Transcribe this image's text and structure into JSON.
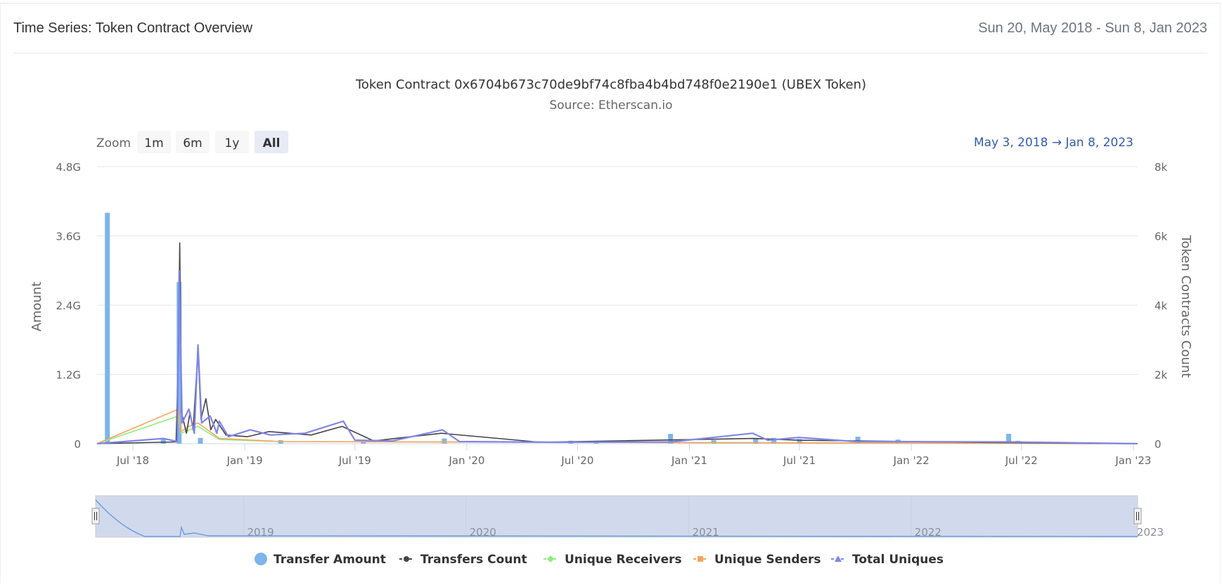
{
  "header": {
    "title": "Time Series: Token Contract Overview",
    "date_range": "Sun 20, May 2018 - Sun 8, Jan 2023"
  },
  "chart_data": {
    "type": "bar",
    "title": "Token Contract 0x6704b673c70de9bf74c8fba4b4bd748f0e2190e1 (UBEX Token)",
    "subtitle": "Source: Etherscan.io",
    "zoom": {
      "label": "Zoom",
      "buttons": [
        "1m",
        "6m",
        "1y",
        "All"
      ],
      "active": "All"
    },
    "range_display": {
      "from": "May 3, 2018",
      "arrow": "→",
      "to": "Jan 8, 2023"
    },
    "ylabel": "Amount",
    "y2label": "Token Contracts Count",
    "ylim": [
      0,
      4800000000
    ],
    "y2lim": [
      0,
      8000
    ],
    "y_ticks": [
      "0",
      "1.2G",
      "2.4G",
      "3.6G",
      "4.8G"
    ],
    "y2_ticks": [
      "0",
      "2k",
      "4k",
      "6k",
      "8k"
    ],
    "x_ticks": [
      "Jul '18",
      "Jan '19",
      "Jul '19",
      "Jan '20",
      "Jul '20",
      "Jan '21",
      "Jul '21",
      "Jan '22",
      "Jul '22",
      "Jan '23"
    ],
    "x_range": [
      "2018-05-03",
      "2023-01-08"
    ],
    "navigator_labels": [
      "2019",
      "2020",
      "2021",
      "2022",
      "2023"
    ],
    "grid": true,
    "legend_position": "bottom",
    "colors": {
      "transfer_amount": "#7cb5ec",
      "transfers_count": "#434348",
      "unique_receivers": "#90ed7d",
      "unique_senders": "#f7a35c",
      "total_uniques": "#8085e9"
    },
    "series": [
      {
        "name": "Transfer Amount",
        "axis": "left",
        "kind": "column",
        "points": [
          [
            "2018-05-20",
            4000000000
          ],
          [
            "2018-08-20",
            80000000
          ],
          [
            "2018-09-15",
            2800000000
          ],
          [
            "2018-10-20",
            100000000
          ],
          [
            "2019-03-01",
            60000000
          ],
          [
            "2019-07-15",
            40000000
          ],
          [
            "2019-11-25",
            90000000
          ],
          [
            "2020-06-20",
            50000000
          ],
          [
            "2020-08-01",
            40000000
          ],
          [
            "2020-12-01",
            170000000
          ],
          [
            "2021-02-10",
            60000000
          ],
          [
            "2021-04-20",
            90000000
          ],
          [
            "2021-05-20",
            100000000
          ],
          [
            "2021-07-01",
            80000000
          ],
          [
            "2021-10-05",
            120000000
          ],
          [
            "2021-12-10",
            70000000
          ],
          [
            "2022-06-10",
            170000000
          ],
          [
            "2022-06-25",
            50000000
          ]
        ]
      },
      {
        "name": "Transfers Count",
        "axis": "right",
        "kind": "line",
        "points": [
          [
            "2018-05-03",
            0
          ],
          [
            "2018-09-10",
            50
          ],
          [
            "2018-09-14",
            2500
          ],
          [
            "2018-09-16",
            5800
          ],
          [
            "2018-09-19",
            900
          ],
          [
            "2018-09-27",
            300
          ],
          [
            "2018-10-03",
            900
          ],
          [
            "2018-10-08",
            400
          ],
          [
            "2018-10-16",
            2700
          ],
          [
            "2018-10-21",
            700
          ],
          [
            "2018-10-29",
            1300
          ],
          [
            "2018-11-06",
            400
          ],
          [
            "2018-11-14",
            700
          ],
          [
            "2018-12-01",
            250
          ],
          [
            "2019-01-05",
            200
          ],
          [
            "2019-02-10",
            350
          ],
          [
            "2019-04-20",
            250
          ],
          [
            "2019-06-10",
            500
          ],
          [
            "2019-08-01",
            80
          ],
          [
            "2019-11-20",
            300
          ],
          [
            "2020-05-01",
            40
          ],
          [
            "2021-04-15",
            150
          ],
          [
            "2021-06-30",
            100
          ],
          [
            "2022-06-01",
            30
          ],
          [
            "2023-01-08",
            0
          ]
        ]
      },
      {
        "name": "Unique Receivers",
        "axis": "right",
        "kind": "line",
        "points": [
          [
            "2018-05-03",
            0
          ],
          [
            "2018-09-14",
            800
          ],
          [
            "2018-09-18",
            300
          ],
          [
            "2018-10-16",
            500
          ],
          [
            "2018-11-20",
            120
          ],
          [
            "2019-03-01",
            60
          ],
          [
            "2019-11-20",
            50
          ],
          [
            "2023-01-08",
            0
          ]
        ]
      },
      {
        "name": "Unique Senders",
        "axis": "right",
        "kind": "line",
        "points": [
          [
            "2018-05-03",
            0
          ],
          [
            "2018-09-14",
            1000
          ],
          [
            "2018-09-18",
            350
          ],
          [
            "2018-10-01",
            500
          ],
          [
            "2018-10-16",
            600
          ],
          [
            "2018-11-20",
            150
          ],
          [
            "2019-03-01",
            60
          ],
          [
            "2023-01-08",
            0
          ]
        ]
      },
      {
        "name": "Total Uniques",
        "axis": "right",
        "kind": "line",
        "points": [
          [
            "2018-05-03",
            0
          ],
          [
            "2018-08-20",
            150
          ],
          [
            "2018-09-12",
            60
          ],
          [
            "2018-09-15",
            5000
          ],
          [
            "2018-09-20",
            600
          ],
          [
            "2018-10-01",
            1000
          ],
          [
            "2018-10-10",
            300
          ],
          [
            "2018-10-16",
            2850
          ],
          [
            "2018-10-22",
            600
          ],
          [
            "2018-11-05",
            800
          ],
          [
            "2018-11-16",
            300
          ],
          [
            "2018-11-20",
            650
          ],
          [
            "2018-12-05",
            200
          ],
          [
            "2019-01-10",
            400
          ],
          [
            "2019-02-12",
            250
          ],
          [
            "2019-04-10",
            300
          ],
          [
            "2019-06-12",
            650
          ],
          [
            "2019-07-01",
            100
          ],
          [
            "2019-09-01",
            80
          ],
          [
            "2019-11-22",
            400
          ],
          [
            "2019-12-20",
            60
          ],
          [
            "2020-06-01",
            40
          ],
          [
            "2020-12-01",
            50
          ],
          [
            "2021-04-15",
            300
          ],
          [
            "2021-05-10",
            100
          ],
          [
            "2021-06-30",
            180
          ],
          [
            "2021-10-01",
            60
          ],
          [
            "2022-06-05",
            50
          ],
          [
            "2023-01-08",
            0
          ]
        ]
      }
    ]
  }
}
